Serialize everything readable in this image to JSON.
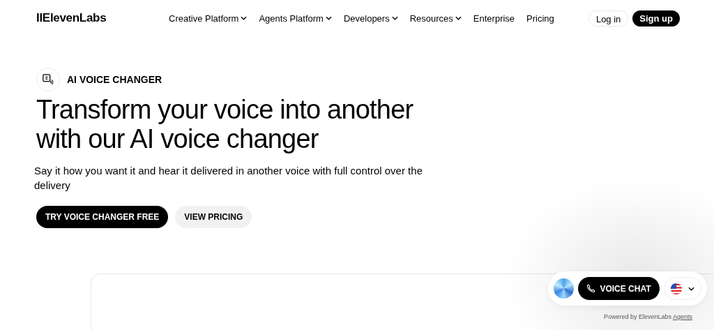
{
  "header": {
    "logo": "IIElevenLabs",
    "nav": [
      {
        "label": "Creative Platform",
        "dropdown": true
      },
      {
        "label": "Agents Platform",
        "dropdown": true
      },
      {
        "label": "Developers",
        "dropdown": true
      },
      {
        "label": "Resources",
        "dropdown": true
      },
      {
        "label": "Enterprise",
        "dropdown": false
      },
      {
        "label": "Pricing",
        "dropdown": false
      }
    ],
    "login": "Log in",
    "signup": "Sign up"
  },
  "hero": {
    "badge": "AI VOICE CHANGER",
    "title": "Transform your voice into another with our AI voice changer",
    "subtitle": "Say it how you want it and hear it delivered in another voice with full control over the delivery",
    "buttons": [
      {
        "label": "TRY VOICE CHANGER FREE",
        "kind": "primary"
      },
      {
        "label": "VIEW PRICING",
        "kind": "secondary"
      }
    ]
  },
  "widget": {
    "button": "VOICE CHAT",
    "powered_by": "Powered by ElevenLabs",
    "powered_link": "Agents"
  }
}
